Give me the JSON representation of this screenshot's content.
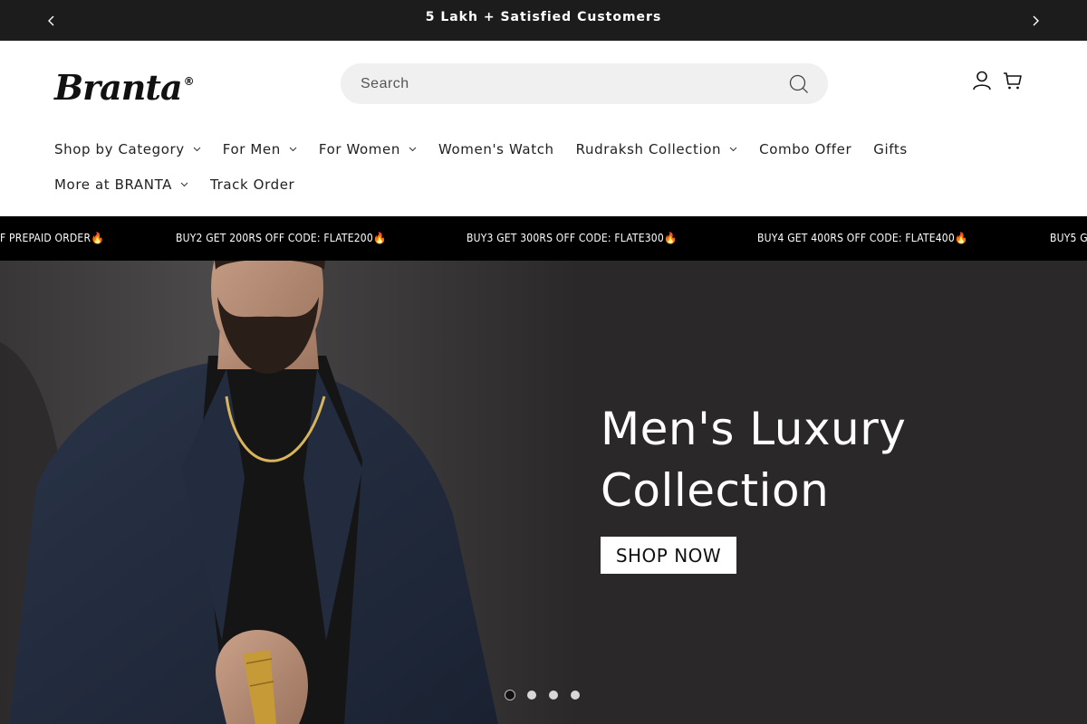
{
  "announcement": {
    "text": "5 Lakh + Satisfied Customers"
  },
  "header": {
    "logo_text": "Branta",
    "logo_mark": "®",
    "search_placeholder": "Search"
  },
  "nav": {
    "row1": [
      {
        "label": "Shop by Category",
        "has_dropdown": true
      },
      {
        "label": "For Men",
        "has_dropdown": true
      },
      {
        "label": "For Women",
        "has_dropdown": true
      },
      {
        "label": "Women's Watch",
        "has_dropdown": false
      },
      {
        "label": "Rudraksh Collection",
        "has_dropdown": true
      },
      {
        "label": "Combo Offer",
        "has_dropdown": false
      },
      {
        "label": "Gifts",
        "has_dropdown": false
      }
    ],
    "row2": [
      {
        "label": "More at BRANTA",
        "has_dropdown": true
      },
      {
        "label": "Track Order",
        "has_dropdown": false
      }
    ]
  },
  "promo": {
    "items": [
      "F PREPAID ORDER🔥",
      "BUY2 GET 200RS OFF CODE: FLATE200🔥",
      "BUY3 GET 300RS OFF CODE: FLATE300🔥",
      "BUY4 GET 400RS OFF CODE: FLATE400🔥",
      "BUY5 G"
    ]
  },
  "hero": {
    "headline_line1": "Men's Luxury",
    "headline_line2": "Collection",
    "cta": "SHOP NOW",
    "slide_count": 4,
    "active_slide": 1
  },
  "colors": {
    "announcement_bg": "#1c1c1c",
    "promo_bg": "#000000",
    "hero_bg": "#2b2829",
    "search_bg": "#f0f0f0"
  },
  "icons": {
    "prev": "chevron-left-icon",
    "next": "chevron-right-icon",
    "search": "search-icon",
    "account": "user-icon",
    "cart": "cart-icon"
  }
}
